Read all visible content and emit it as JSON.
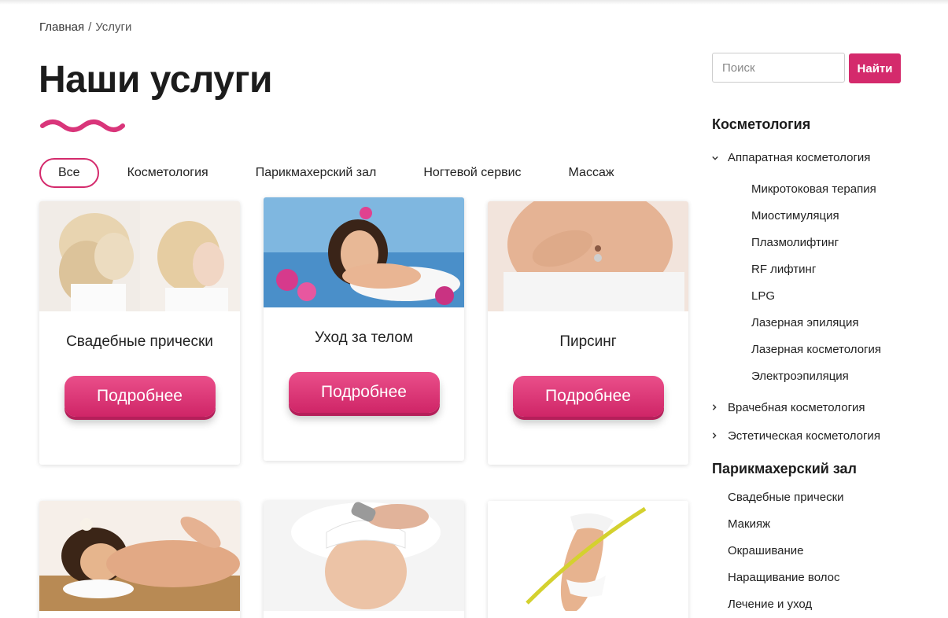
{
  "breadcrumb": {
    "home": "Главная",
    "separator": "/",
    "current": "Услуги"
  },
  "page": {
    "title": "Наши услуги"
  },
  "filters": [
    "Все",
    "Косметология",
    "Парикмахерский зал",
    "Ногтевой сервис",
    "Массаж"
  ],
  "cards": [
    {
      "title": "Свадебные прически",
      "button": "Подробнее"
    },
    {
      "title": "Уход за телом",
      "button": "Подробнее"
    },
    {
      "title": "Пирсинг",
      "button": "Подробнее"
    }
  ],
  "search": {
    "placeholder": "Поиск",
    "button": "Найти"
  },
  "sidebar": {
    "cosmetology_title": "Косметология",
    "hardware_title": "Аппаратная косметология",
    "hardware_items": [
      "Микротоковая терапия",
      "Миостимуляция",
      "Плазмолифтинг",
      "RF лифтинг",
      "LPG",
      "Лазерная эпиляция",
      "Лазерная косметология",
      "Электроэпиляция"
    ],
    "medical_title": "Врачебная косметология",
    "aesthetic_title": "Эстетическая косметология",
    "hair_title": "Парикмахерский зал",
    "hair_items": [
      "Свадебные прически",
      "Макияж",
      "Окрашивание",
      "Наращивание волос",
      "Лечение и уход"
    ]
  },
  "colors": {
    "accent": "#d42a6c"
  }
}
